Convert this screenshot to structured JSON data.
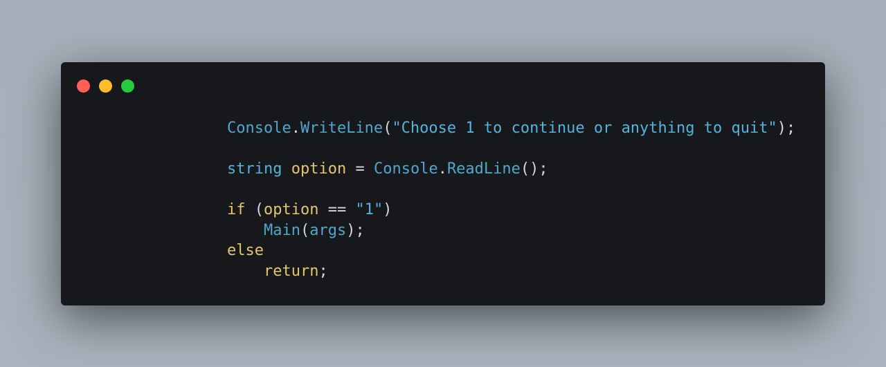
{
  "window": {
    "controls": [
      {
        "name": "close",
        "color": "#ff5f56"
      },
      {
        "name": "minimize",
        "color": "#ffbd2e"
      },
      {
        "name": "maximize",
        "color": "#27c93f"
      }
    ]
  },
  "code": {
    "lines": [
      [
        {
          "text": "Console",
          "kind": "cls"
        },
        {
          "text": ".",
          "kind": "punc"
        },
        {
          "text": "WriteLine",
          "kind": "fn"
        },
        {
          "text": "(",
          "kind": "punc"
        },
        {
          "text": "\"Choose 1 to continue or anything to quit\"",
          "kind": "str"
        },
        {
          "text": ");",
          "kind": "punc"
        }
      ],
      [],
      [
        {
          "text": "string",
          "kind": "type"
        },
        {
          "text": " ",
          "kind": "punc"
        },
        {
          "text": "option",
          "kind": "var"
        },
        {
          "text": " = ",
          "kind": "op"
        },
        {
          "text": "Console",
          "kind": "cls"
        },
        {
          "text": ".",
          "kind": "punc"
        },
        {
          "text": "ReadLine",
          "kind": "fn"
        },
        {
          "text": "();",
          "kind": "punc"
        }
      ],
      [],
      [
        {
          "text": "if",
          "kind": "kw"
        },
        {
          "text": " (",
          "kind": "punc"
        },
        {
          "text": "option",
          "kind": "var"
        },
        {
          "text": " == ",
          "kind": "op"
        },
        {
          "text": "\"1\"",
          "kind": "str"
        },
        {
          "text": ")",
          "kind": "punc"
        }
      ],
      [
        {
          "text": "    ",
          "kind": "punc"
        },
        {
          "text": "Main",
          "kind": "fn"
        },
        {
          "text": "(",
          "kind": "punc"
        },
        {
          "text": "args",
          "kind": "fn"
        },
        {
          "text": ");",
          "kind": "punc"
        }
      ],
      [
        {
          "text": "else",
          "kind": "kw"
        }
      ],
      [
        {
          "text": "    ",
          "kind": "punc"
        },
        {
          "text": "return",
          "kind": "kw"
        },
        {
          "text": ";",
          "kind": "punc"
        }
      ]
    ]
  }
}
